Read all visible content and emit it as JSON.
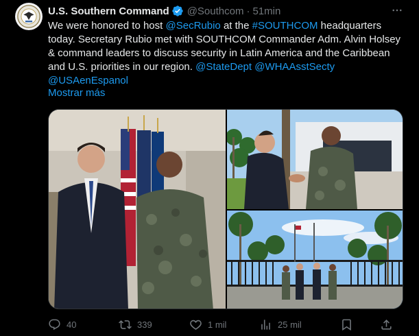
{
  "author": {
    "name": "U.S. Southern Command",
    "handle": "@Southcom",
    "separator": "·",
    "time": "51min"
  },
  "tweet": {
    "text_lead": "We were honored to host ",
    "mention_rubio": "@SecRubio",
    "text_at": " at the ",
    "hashtag": "#SOUTHCOM",
    "text_body": " headquarters today. Secretary Rubio met with SOUTHCOM Commander Adm. Alvin Holsey & command leaders to discuss security in Latin America and the Caribbean and U.S. priorities in our region. ",
    "mention_state": "@StateDept",
    "space": " ",
    "mention_wha": "@WHAAsstSecty",
    "mention_usaen": "@USAenEspanol",
    "show_more": "Mostrar más"
  },
  "stats": {
    "replies": "40",
    "retweets": "339",
    "likes": "1 mil",
    "views": "25 mil"
  },
  "colors": {
    "background": "#000000",
    "text": "#e7e9ea",
    "muted": "#71767b",
    "accent": "#1d9bf0"
  },
  "icons": {
    "verified": "verified-badge-icon",
    "more": "more-icon",
    "reply": "reply-icon",
    "retweet": "retweet-icon",
    "like": "heart-icon",
    "views": "views-icon",
    "bookmark": "bookmark-icon",
    "share": "share-icon"
  }
}
